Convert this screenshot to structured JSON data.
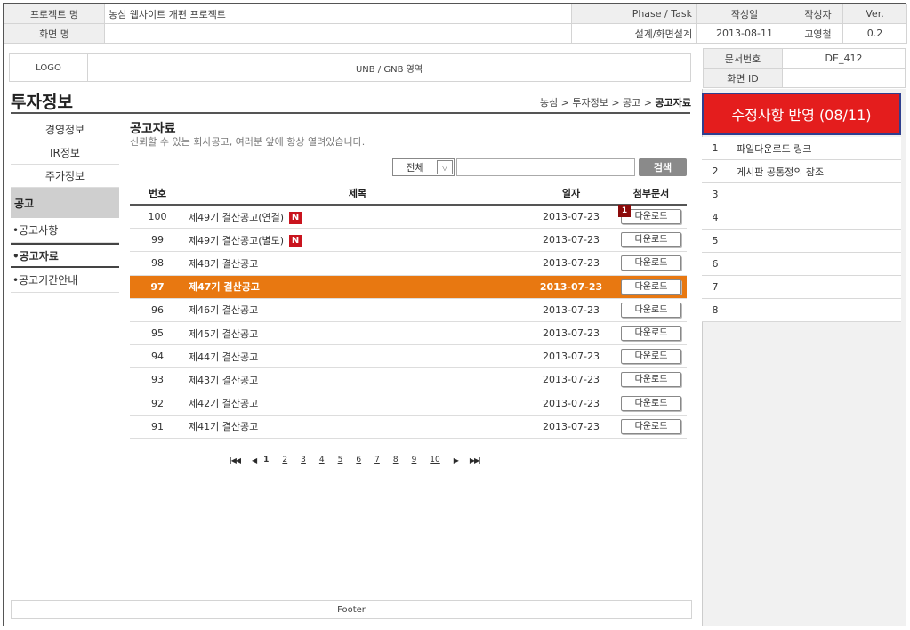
{
  "meta": {
    "project_label": "프로젝트 명",
    "project_value": "농심 웹사이트 개편 프로젝트",
    "phase_label": "Phase / Task",
    "phase_value": "설계/화면설계",
    "screen_label": "화면 명",
    "date_label": "작성일",
    "date_value": "2013-08-11",
    "author_label": "작성자",
    "author_value": "고영철",
    "ver_label": "Ver.",
    "ver_value": "0.2",
    "doc_no_label": "문서번호",
    "doc_no_value": "DE_412",
    "screen_id_label": "화면 ID"
  },
  "header": {
    "logo": "LOGO",
    "unb": "UNB / GNB 영역"
  },
  "page": {
    "title": "투자정보",
    "breadcrumb": "농심 > 투자정보 > 공고 > ",
    "breadcrumb_current": "공고자료"
  },
  "lnb": {
    "items": [
      "경영정보",
      "IR정보",
      "주가정보"
    ],
    "category": "공고",
    "subs": [
      "•공고사항",
      "•공고자료",
      "•공고기간안내"
    ]
  },
  "content": {
    "title": "공고자료",
    "desc": "신뢰할 수 있는 회사공고, 여러분 앞에 항상 열려있습니다.",
    "select_value": "전체",
    "search_button": "검색",
    "columns": [
      "번호",
      "제목",
      "일자",
      "첨부문서"
    ],
    "download_label": "다운로드",
    "new_badge": "N",
    "rows": [
      {
        "no": "100",
        "title": "제49기 결산공고(연결)",
        "date": "2013-07-23",
        "new": true
      },
      {
        "no": "99",
        "title": "제49기 결산공고(별도)",
        "date": "2013-07-23",
        "new": true
      },
      {
        "no": "98",
        "title": "제48기 결산공고",
        "date": "2013-07-23",
        "new": false
      },
      {
        "no": "97",
        "title": "제47기 결산공고",
        "date": "2013-07-23",
        "new": false,
        "selected": true
      },
      {
        "no": "96",
        "title": "제46기 결산공고",
        "date": "2013-07-23",
        "new": false
      },
      {
        "no": "95",
        "title": "제45기 결산공고",
        "date": "2013-07-23",
        "new": false
      },
      {
        "no": "94",
        "title": "제44기 결산공고",
        "date": "2013-07-23",
        "new": false
      },
      {
        "no": "93",
        "title": "제43기 결산공고",
        "date": "2013-07-23",
        "new": false
      },
      {
        "no": "92",
        "title": "제42기 결산공고",
        "date": "2013-07-23",
        "new": false
      },
      {
        "no": "91",
        "title": "제41기 결산공고",
        "date": "2013-07-23",
        "new": false
      }
    ],
    "annotation_marker": "1",
    "pagination": {
      "first": "|◀◀",
      "prev": "◀",
      "pages": [
        "1",
        "2",
        "3",
        "4",
        "5",
        "6",
        "7",
        "8",
        "9",
        "10"
      ],
      "current": "1",
      "next": "▶",
      "last": "▶▶|"
    }
  },
  "right_panel": {
    "banner": "수정사항 반영 (08/11)",
    "notes": [
      {
        "num": "1",
        "text": "파일다운로드 링크"
      },
      {
        "num": "2",
        "text": "게시판 공통정의 참조"
      },
      {
        "num": "3",
        "text": ""
      },
      {
        "num": "4",
        "text": ""
      },
      {
        "num": "5",
        "text": ""
      },
      {
        "num": "6",
        "text": ""
      },
      {
        "num": "7",
        "text": ""
      },
      {
        "num": "8",
        "text": ""
      }
    ]
  },
  "footer": "Footer",
  "colors": {
    "selected_row": "#e87811",
    "banner": "#e41d1d",
    "new_badge": "#c9141e"
  }
}
